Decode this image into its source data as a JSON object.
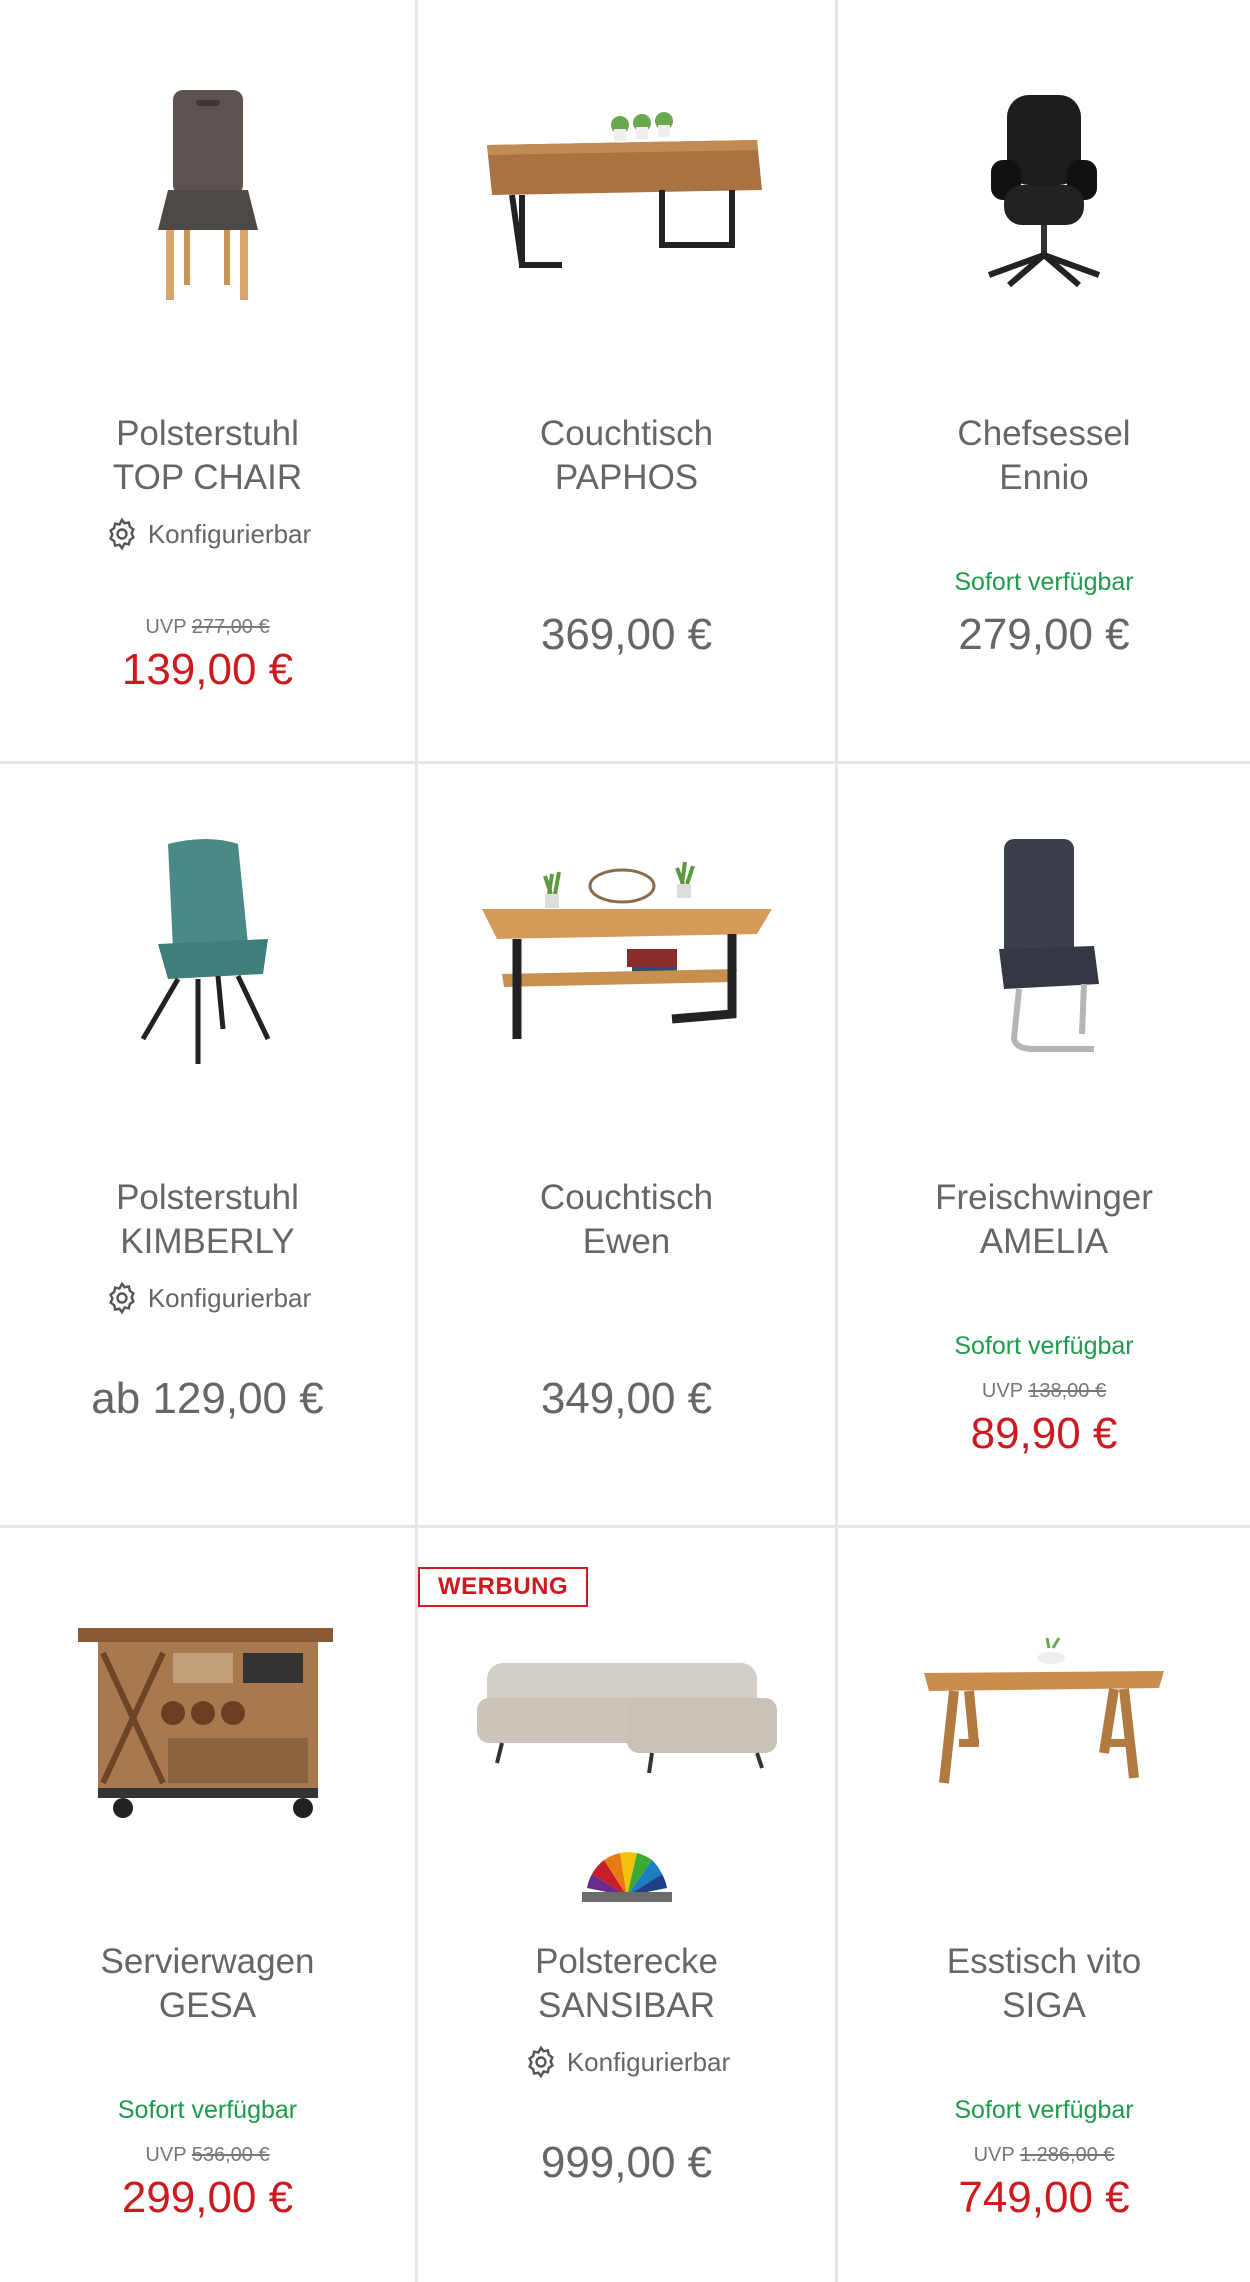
{
  "colors": {
    "sale_price": "#cc1a1f",
    "availability": "#1e9a4a",
    "text": "#666666",
    "divider": "#e6e6e6",
    "ad_badge": "#cc1a1f"
  },
  "products": [
    {
      "line1": "Polsterstuhl",
      "line2": "TOP CHAIR",
      "configurable": "Konfigurierbar",
      "availability": "",
      "uvp_label": "UVP",
      "uvp_price": "277,00 €",
      "price": "139,00 €",
      "image_icon": "upholstered-chair-icon"
    },
    {
      "line1": "Couchtisch",
      "line2": "PAPHOS",
      "configurable": "",
      "availability": "",
      "uvp_label": "",
      "uvp_price": "",
      "price": "369,00 €",
      "image_icon": "coffee-table-icon"
    },
    {
      "line1": "Chefsessel",
      "line2": "Ennio",
      "configurable": "",
      "availability": "Sofort verfügbar",
      "uvp_label": "",
      "uvp_price": "",
      "price": "279,00 €",
      "image_icon": "office-chair-icon"
    },
    {
      "line1": "Polsterstuhl",
      "line2": "KIMBERLY",
      "configurable": "Konfigurierbar",
      "availability": "",
      "uvp_label": "",
      "uvp_price": "",
      "price": "ab 129,00 €",
      "image_icon": "teal-chair-icon"
    },
    {
      "line1": "Couchtisch",
      "line2": "Ewen",
      "configurable": "",
      "availability": "",
      "uvp_label": "",
      "uvp_price": "",
      "price": "349,00 €",
      "image_icon": "coffee-table-shelf-icon"
    },
    {
      "line1": "Freischwinger",
      "line2": "AMELIA",
      "configurable": "",
      "availability": "Sofort verfügbar",
      "uvp_label": "UVP",
      "uvp_price": "138,00 €",
      "price": "89,90 €",
      "image_icon": "cantilever-chair-icon"
    },
    {
      "line1": "Servierwagen",
      "line2": "GESA",
      "configurable": "",
      "availability": "Sofort verfügbar",
      "uvp_label": "UVP",
      "uvp_price": "536,00 €",
      "price": "299,00 €",
      "image_icon": "serving-cart-icon"
    },
    {
      "line1": "Polsterecke",
      "line2": "SANSIBAR",
      "configurable": "Konfigurierbar",
      "availability": "",
      "uvp_label": "",
      "uvp_price": "",
      "price": "999,00 €",
      "badge": "WERBUNG",
      "image_icon": "corner-sofa-icon",
      "brand_icon": "brand-fan-logo-icon"
    },
    {
      "line1": "Esstisch vito",
      "line2": "SIGA",
      "configurable": "",
      "availability": "Sofort verfügbar",
      "uvp_label": "UVP",
      "uvp_price": "1.286,00 €",
      "price": "749,00 €",
      "image_icon": "dining-table-icon"
    }
  ]
}
